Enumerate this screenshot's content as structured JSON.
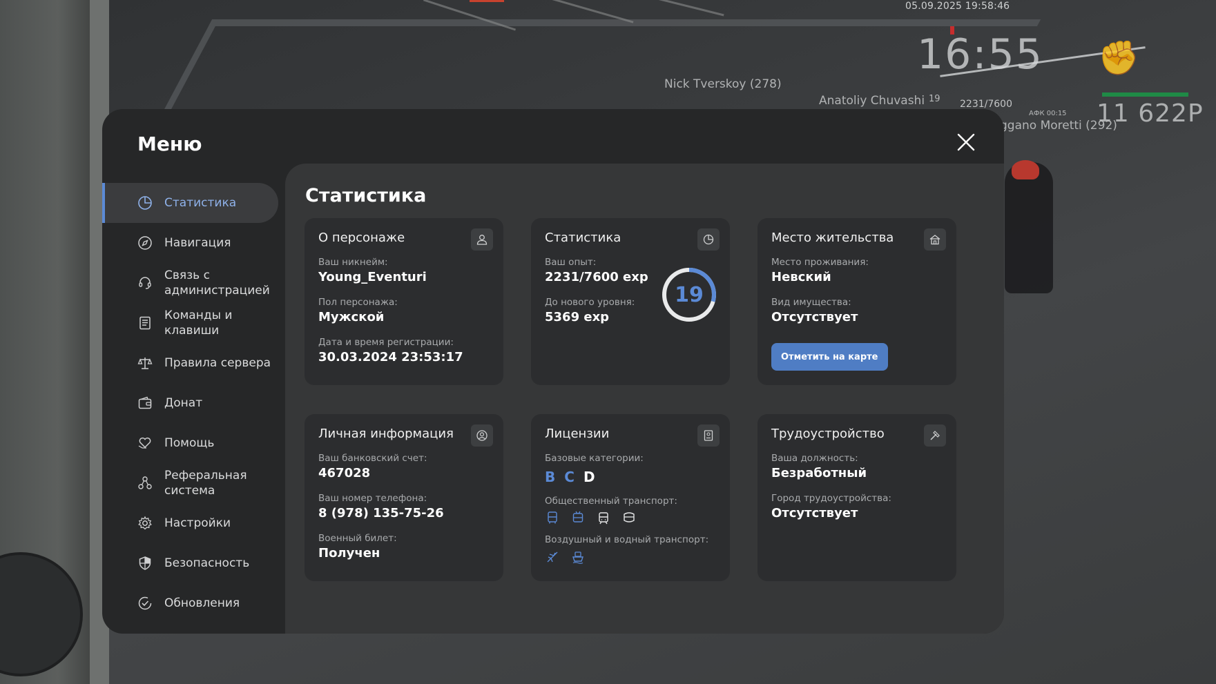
{
  "hud": {
    "datetime": "05.09.2025 19:58:46",
    "clock": "16:55",
    "level": "19",
    "exp": "2231/7600",
    "afk": "АФК 00:15",
    "money": "11 622P",
    "nicks": [
      "Nick Tverskoy (278)",
      "Anatoliy Chuvashi",
      "ggano Moretti (292)"
    ]
  },
  "menu": {
    "title": "Меню",
    "sidebar": [
      {
        "label": "Статистика",
        "icon": "pie-chart-icon",
        "active": true
      },
      {
        "label": "Навигация",
        "icon": "compass-icon",
        "active": false
      },
      {
        "label": "Связь с\nадминистрацией",
        "icon": "headset-icon",
        "active": false
      },
      {
        "label": "Команды и\nклавиши",
        "icon": "document-icon",
        "active": false
      },
      {
        "label": "Правила сервера",
        "icon": "scales-icon",
        "active": false
      },
      {
        "label": "Донат",
        "icon": "wallet-icon",
        "active": false
      },
      {
        "label": "Помощь",
        "icon": "heart-hand-icon",
        "active": false
      },
      {
        "label": "Реферальная\nсистема",
        "icon": "network-icon",
        "active": false
      },
      {
        "label": "Настройки",
        "icon": "gear-icon",
        "active": false
      },
      {
        "label": "Безопасность",
        "icon": "shield-icon",
        "active": false
      },
      {
        "label": "Обновления",
        "icon": "check-circle-icon",
        "active": false
      }
    ]
  },
  "content": {
    "title": "Статистика",
    "character": {
      "title": "О персонаже",
      "nickname_label": "Ваш никнейм:",
      "nickname": "Young_Eventuri",
      "gender_label": "Пол персонажа:",
      "gender": "Мужской",
      "reg_label": "Дата и время регистрации:",
      "reg": "30.03.2024 23:53:17"
    },
    "stats": {
      "title": "Статистика",
      "exp_label": "Ваш опыт:",
      "exp": "2231/7600 exp",
      "next_label": "До нового уровня:",
      "next": "5369 exp",
      "level": "19",
      "progress": 0.2936
    },
    "residence": {
      "title": "Место жительства",
      "place_label": "Место проживания:",
      "place": "Невский",
      "property_label": "Вид имущества:",
      "property": "Отсутствует",
      "button": "Отметить на карте"
    },
    "personal": {
      "title": "Личная информация",
      "bank_label": "Ваш банковский счет:",
      "bank": "467028",
      "phone_label": "Ваш номер телефона:",
      "phone": "8 (978) 135-75-26",
      "military_label": "Военный билет:",
      "military": "Получен"
    },
    "licenses": {
      "title": "Лицензии",
      "base_label": "Базовые категории:",
      "categories": [
        {
          "name": "B",
          "owned": false
        },
        {
          "name": "C",
          "owned": false
        },
        {
          "name": "D",
          "owned": true
        }
      ],
      "public_label": "Общественный транспорт:",
      "air_label": "Воздушный и водный транспорт:"
    },
    "job": {
      "title": "Трудоустройство",
      "position_label": "Ваша должность:",
      "position": "Безработный",
      "city_label": "Город трудоустройства:",
      "city": "Отсутствует"
    }
  },
  "colors": {
    "accent": "#5b8ad6",
    "button": "#4f7dc4",
    "panel": "#262728",
    "content": "#363738",
    "card": "#2c2d2f"
  }
}
